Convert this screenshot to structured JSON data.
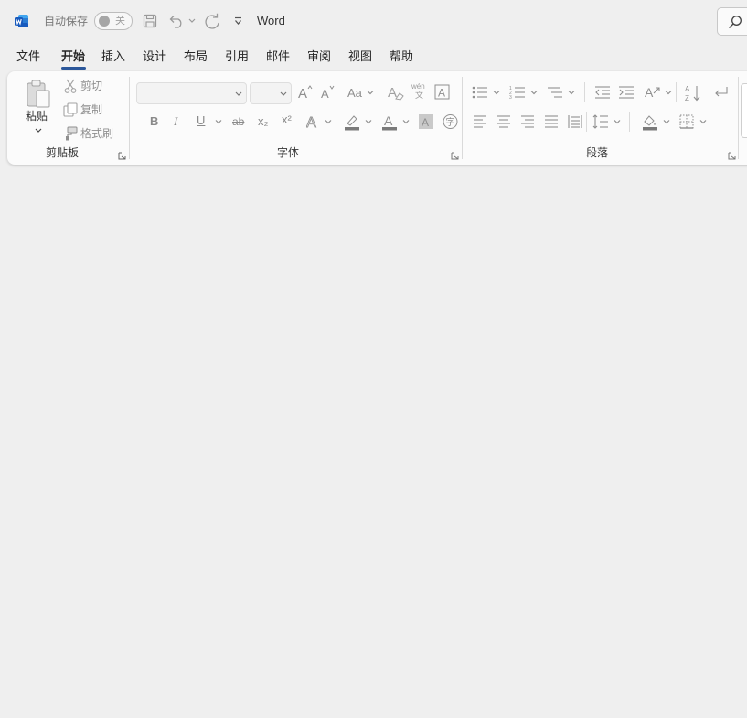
{
  "titlebar": {
    "autosave_label": "自动保存",
    "autosave_state": "关",
    "doc_title": "Word",
    "icons": [
      "word-logo-icon",
      "save-icon",
      "undo-icon",
      "redo-icon",
      "customize-toolbar-icon",
      "search-icon"
    ]
  },
  "tabs": [
    {
      "label": "文件"
    },
    {
      "label": "开始",
      "active": true
    },
    {
      "label": "插入"
    },
    {
      "label": "设计"
    },
    {
      "label": "布局"
    },
    {
      "label": "引用"
    },
    {
      "label": "邮件"
    },
    {
      "label": "审阅"
    },
    {
      "label": "视图"
    },
    {
      "label": "帮助"
    }
  ],
  "ribbon": {
    "clipboard": {
      "group_label": "剪贴板",
      "paste_label": "粘贴",
      "cut_label": "剪切",
      "copy_label": "复制",
      "format_painter_label": "格式刷"
    },
    "font": {
      "group_label": "字体",
      "font_name_value": "",
      "font_size_value": "",
      "bold": "B",
      "italic": "I",
      "underline": "U",
      "strikethrough": "ab",
      "subscript": "x₂",
      "superscript": "x²",
      "phonetic": "wén"
    },
    "paragraph": {
      "group_label": "段落"
    }
  },
  "colors": {
    "accent": "#2b579a",
    "word_blue": "#185abd",
    "highlight_bar": "#7a7a7a",
    "font_color_bar": "#7a7a7a"
  }
}
